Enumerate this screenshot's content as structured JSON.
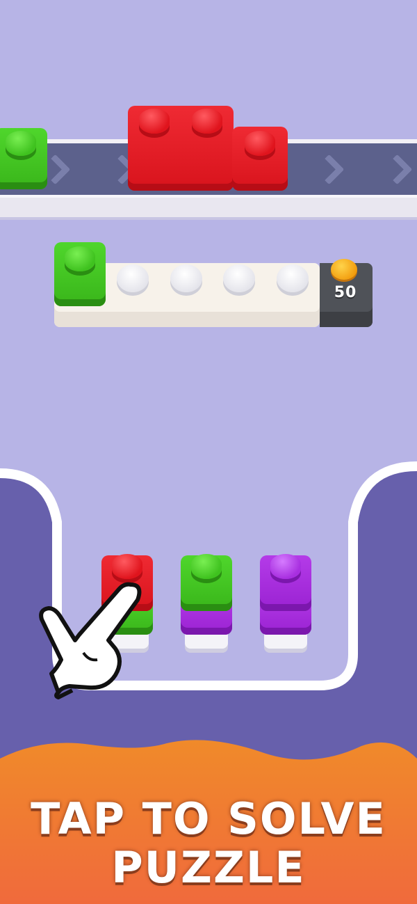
{
  "slot_tray": {
    "empty_slots": 4,
    "reward_value": "50",
    "reward_icon": "coin-icon"
  },
  "stacks": [
    {
      "layers": [
        "red",
        "green"
      ]
    },
    {
      "layers": [
        "green",
        "purple"
      ]
    },
    {
      "layers": [
        "purple",
        "purple"
      ]
    }
  ],
  "banner": {
    "line1": "TAP TO SOLVE",
    "line2": "PUZZLE"
  },
  "colors": {
    "background": "#b7b4e6",
    "pit": "#6760ac",
    "banner_top": "#f08a2a",
    "banner_bottom": "#f06a3c",
    "red": "#e0141d",
    "green": "#3fc21f",
    "purple": "#a82fe0"
  }
}
